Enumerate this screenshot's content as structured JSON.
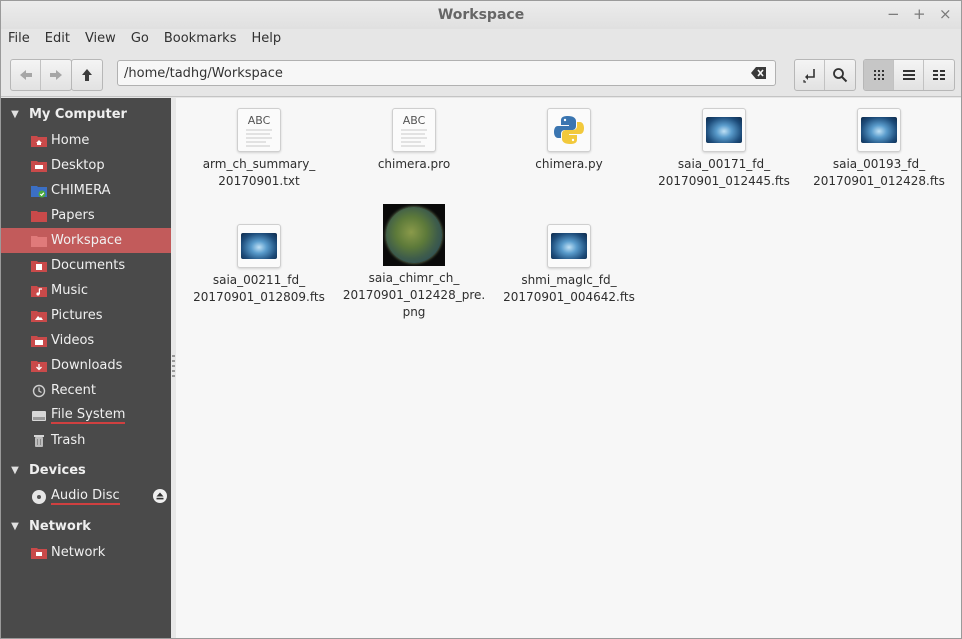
{
  "window": {
    "title": "Workspace"
  },
  "window_controls": {
    "minimize": "−",
    "maximize": "+",
    "close": "×"
  },
  "menu": [
    "File",
    "Edit",
    "View",
    "Go",
    "Bookmarks",
    "Help"
  ],
  "location": {
    "path": "/home/tadhg/Workspace"
  },
  "sidebar": {
    "sections": [
      {
        "title": "My Computer"
      },
      {
        "title": "Devices"
      },
      {
        "title": "Network"
      }
    ],
    "my_computer": [
      {
        "label": "Home",
        "icon": "home-folder-icon"
      },
      {
        "label": "Desktop",
        "icon": "desktop-folder-icon"
      },
      {
        "label": "CHIMERA",
        "icon": "shared-folder-icon"
      },
      {
        "label": "Papers",
        "icon": "folder-icon"
      },
      {
        "label": "Workspace",
        "icon": "folder-icon",
        "selected": true
      },
      {
        "label": "Documents",
        "icon": "documents-folder-icon"
      },
      {
        "label": "Music",
        "icon": "music-folder-icon"
      },
      {
        "label": "Pictures",
        "icon": "pictures-folder-icon"
      },
      {
        "label": "Videos",
        "icon": "videos-folder-icon"
      },
      {
        "label": "Downloads",
        "icon": "downloads-folder-icon"
      },
      {
        "label": "Recent",
        "icon": "recent-icon"
      },
      {
        "label": "File System",
        "icon": "drive-icon"
      },
      {
        "label": "Trash",
        "icon": "trash-icon"
      }
    ],
    "devices": [
      {
        "label": "Audio Disc",
        "icon": "disc-icon"
      }
    ],
    "network": [
      {
        "label": "Network",
        "icon": "network-icon"
      }
    ]
  },
  "files": [
    {
      "name": "arm_ch_summary_\n20170901.txt",
      "type": "text",
      "icon_text": "ABC"
    },
    {
      "name": "chimera.pro",
      "type": "text",
      "icon_text": "ABC"
    },
    {
      "name": "chimera.py",
      "type": "python"
    },
    {
      "name": "saia_00171_fd_\n20170901_012445.fts",
      "type": "fits"
    },
    {
      "name": "saia_00193_fd_\n20170901_012428.fts",
      "type": "fits"
    },
    {
      "name": "saia_00211_fd_\n20170901_012809.fts",
      "type": "fits"
    },
    {
      "name": "saia_chimr_ch_\n20170901_012428_pre.\npng",
      "type": "png"
    },
    {
      "name": "shmi_maglc_fd_\n20170901_004642.fts",
      "type": "fits"
    }
  ],
  "colors": {
    "selection": "#c25b5b",
    "sidebar_bg": "#4a4a4a",
    "content_bg": "#f7f7f7"
  }
}
